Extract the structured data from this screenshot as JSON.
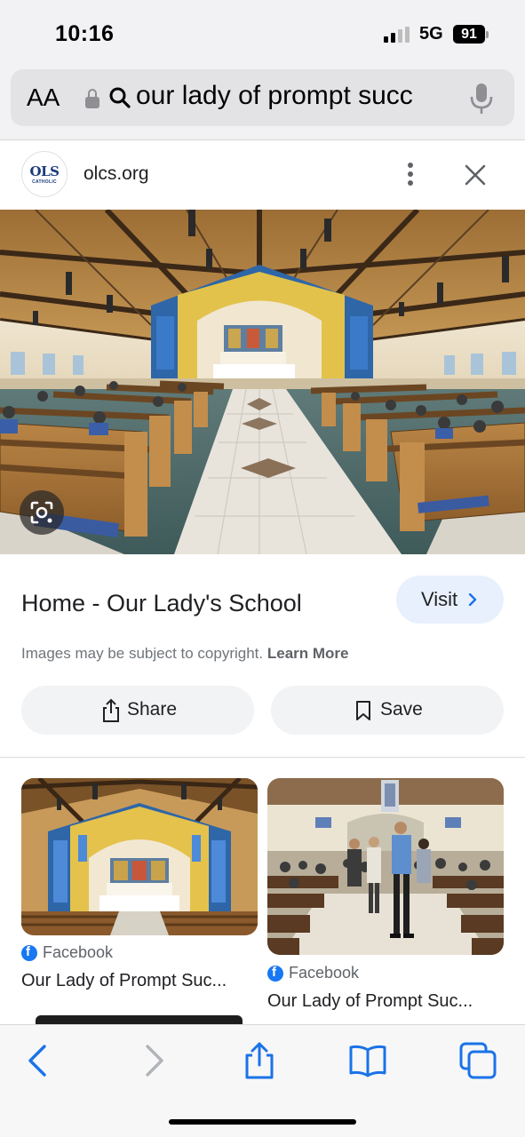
{
  "status_bar": {
    "time": "10:16",
    "network": "5G",
    "battery": "91"
  },
  "url_bar": {
    "aa_label": "AA",
    "query": "our lady of prompt succ"
  },
  "site": {
    "logo_text": "OLS",
    "logo_sub": "CATHOLIC",
    "domain": "olcs.org"
  },
  "result": {
    "title": "Home - Our Lady's School",
    "visit_label": "Visit",
    "copyright_text": "Images may be subject to copyright.",
    "learn_more": "Learn More",
    "share_label": "Share",
    "save_label": "Save"
  },
  "related": [
    {
      "source": "Facebook",
      "title": "Our Lady of Prompt Suc..."
    },
    {
      "source": "Facebook",
      "title": "Our Lady of Prompt Suc..."
    }
  ],
  "icons": {
    "lock": "lock-icon",
    "search": "search-icon",
    "mic": "microphone-icon",
    "more": "more-vert-icon",
    "close": "close-icon",
    "lens": "google-lens-icon",
    "share": "share-icon",
    "save": "bookmark-icon",
    "back": "back-icon",
    "forward": "forward-icon",
    "bookmarks": "book-icon",
    "tabs": "tabs-icon"
  },
  "colors": {
    "accent": "#1a73e8",
    "visit_bg": "#e8f0fe",
    "pill_bg": "#f1f3f4",
    "facebook": "#1877f2"
  }
}
